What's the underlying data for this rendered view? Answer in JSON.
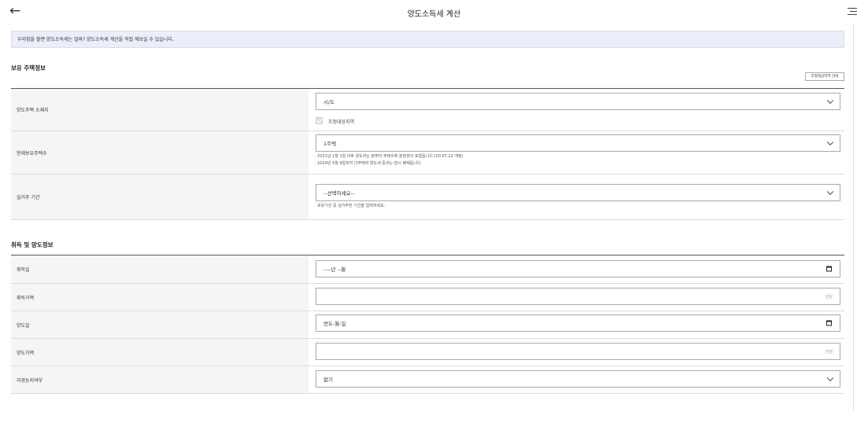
{
  "header": {
    "back_icon": "←",
    "title": "양도소득세 계산",
    "menu_icon": "hamburger-menu-icon"
  },
  "notice": "우리집을 팔면 양도소득세는 얼마? 양도소득세 계산을 직접 해보실 수 있습니다.",
  "holding": {
    "section_title": "보유 주택정보",
    "guide_button": "조정대상지역 안내",
    "location_label": "양도주택 소재지",
    "location_value": "시/도",
    "regulated_checkbox_label": "조정대상지역",
    "count_label": "현재보유주택수",
    "count_value": "1주택",
    "count_help_1": "· 2021년 1월 1일 이후 양도하는 분부터 주택수에 분양권이 포함됩니다.(20.07.22 개정)",
    "count_help_2": "· 2024년 5월 9일까지 다주택자 양도세 중과는 한시 배제됩니다.",
    "residence_label": "실거주 기간",
    "residence_value": "--선택하세요--",
    "residence_help": "· 보유기간 중 실거주한 기간을 입력하세요."
  },
  "acquisition": {
    "section_title": "취득 및 양도정보",
    "acq_date_label": "취득일",
    "acq_date_value": "----년 --월",
    "acq_price_label": "취득가액",
    "acq_price_unit": "만원",
    "sale_date_label": "양도일",
    "sale_date_value": "연도-월-일",
    "sale_price_label": "양도가액",
    "sale_price_unit": "만원",
    "self_farming_label": "자경농지여부",
    "self_farming_value": "없기"
  }
}
